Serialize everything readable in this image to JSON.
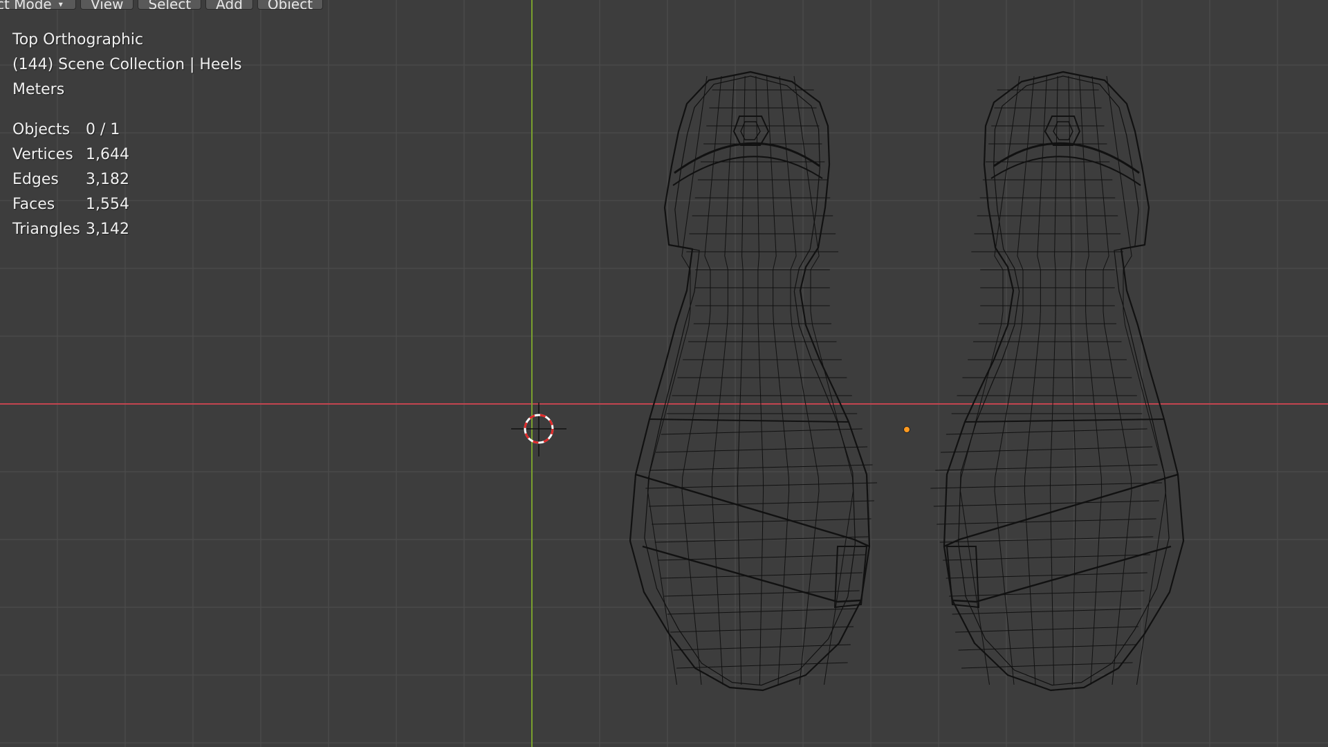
{
  "header": {
    "mode_label": "ct Mode",
    "mode_arrow_icon": "chevron-down-icon",
    "menu": [
      "View",
      "Select",
      "Add",
      "Object"
    ]
  },
  "overlay": {
    "view_name": "Top Orthographic",
    "collection": "(144) Scene Collection | Heels",
    "units": "Meters",
    "stats": [
      {
        "label": "Objects",
        "value": "0 / 1"
      },
      {
        "label": "Vertices",
        "value": "1,644"
      },
      {
        "label": "Edges",
        "value": "3,182"
      },
      {
        "label": "Faces",
        "value": "1,554"
      },
      {
        "label": "Triangles",
        "value": "3,142"
      }
    ]
  },
  "colors": {
    "background": "#3d3d3d",
    "grid": "#4a4a4a",
    "x_axis": "#c4454f",
    "y_axis": "#7aa12e",
    "wireframe": "#111111",
    "origin": "#ff9a1f",
    "cursor_red": "#e02a2a",
    "cursor_white": "#ffffff"
  },
  "scene": {
    "object_name": "Heels",
    "cursor_icon": "3d-cursor-icon",
    "origin_icon": "object-origin-dot-icon"
  }
}
